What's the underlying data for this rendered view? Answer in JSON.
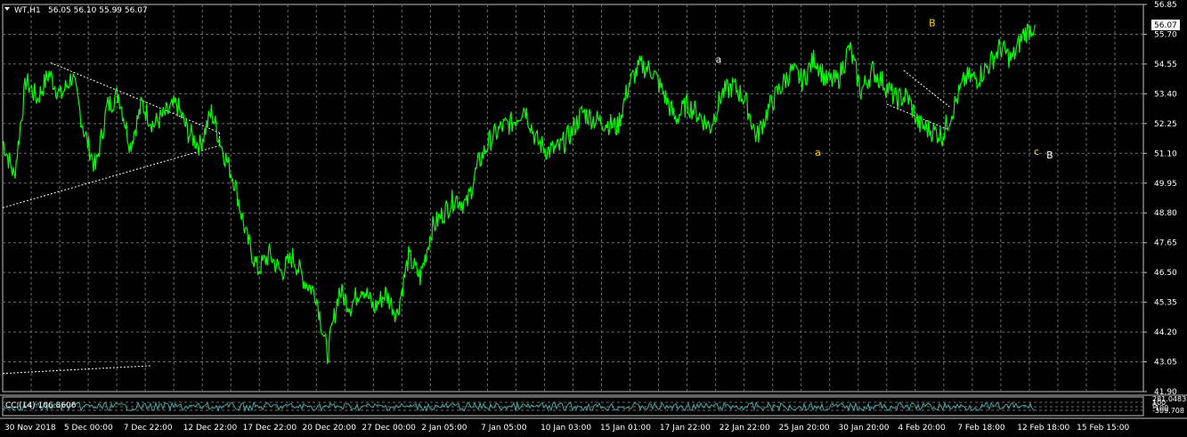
{
  "header": {
    "symbol_label": "WT,H1",
    "ohlc": "56.05 56.10 55.99 56.07",
    "menu_icon": "triangle-down-icon"
  },
  "current_price": "56.07",
  "indicator": {
    "label": "CCI(14) 106.8606",
    "right_values": [
      "281.0483",
      "100",
      "0",
      "-100",
      "-309.708"
    ]
  },
  "colors": {
    "background": "#000000",
    "grid": "#6f6f6f",
    "price": "#00ff00",
    "trendline": "#ffffff",
    "wave_small": "#ffd400",
    "wave_big": "#ffffff",
    "cci": "#4aa3a3",
    "price_box_bg": "#ffffff"
  },
  "chart_data": {
    "type": "line",
    "title": "WT,H1",
    "ylim": [
      41.9,
      56.85
    ],
    "y_ticks": [
      "56.85",
      "55.70",
      "54.55",
      "53.40",
      "52.25",
      "51.10",
      "49.95",
      "48.80",
      "47.65",
      "46.50",
      "45.35",
      "44.20",
      "43.05",
      "41.90"
    ],
    "x_ticks": [
      "30 Nov 2018",
      "5 Dec 00:00",
      "7 Dec 22:00",
      "12 Dec 22:00",
      "17 Dec 22:00",
      "20 Dec 20:00",
      "27 Dec 00:00",
      "2 Jan 05:00",
      "7 Jan 05:00",
      "10 Jan 03:00",
      "15 Jan 01:00",
      "17 Jan 22:00",
      "22 Jan 22:00",
      "25 Jan 20:00",
      "30 Jan 20:00",
      "4 Feb 20:00",
      "7 Feb 18:00",
      "12 Feb 18:00",
      "15 Feb 15:00"
    ],
    "grid": true,
    "series": [
      {
        "values": [
          51.6,
          50.2,
          53.9,
          53.2,
          54.2,
          53.3,
          54.1,
          52.0,
          50.5,
          52.9,
          53.4,
          51.4,
          53.0,
          52.2,
          52.6,
          53.0,
          51.9,
          51.4,
          52.7,
          51.2,
          50.0,
          47.9,
          46.6,
          47.2,
          46.5,
          47.1,
          46.2,
          45.7,
          43.3,
          45.8,
          45.2,
          46.0,
          45.1,
          45.7,
          44.9,
          47.1,
          46.3,
          48.2,
          48.8,
          49.4,
          49.1,
          50.7,
          51.6,
          52.1,
          52.3,
          52.9,
          51.6,
          51.2,
          51.3,
          51.9,
          52.7,
          52.4,
          52.3,
          52.1,
          53.8,
          54.5,
          54.3,
          53.4,
          52.4,
          53.0,
          52.6,
          52.1,
          53.4,
          53.7,
          53.2,
          51.7,
          52.8,
          53.6,
          54.3,
          53.9,
          54.8,
          53.9,
          53.9,
          55.2,
          53.5,
          54.3,
          53.8,
          53.2,
          53.3,
          52.2,
          52.0,
          51.8,
          52.9,
          54.0,
          54.0,
          54.5,
          55.2,
          54.7,
          55.7,
          56.07
        ]
      }
    ],
    "wave_labels": [
      {
        "text": "a",
        "style": "big",
        "t": 0.625,
        "price": 54.6
      },
      {
        "text": "a",
        "style": "small",
        "t": 0.712,
        "price": 51.0
      },
      {
        "text": "B",
        "style": "small",
        "t": 0.812,
        "price": 56.0
      },
      {
        "text": "c",
        "style": "small",
        "t": 0.904,
        "price": 51.05
      },
      {
        "text": "B",
        "style": "big",
        "t": 0.915,
        "price": 50.9
      }
    ]
  }
}
